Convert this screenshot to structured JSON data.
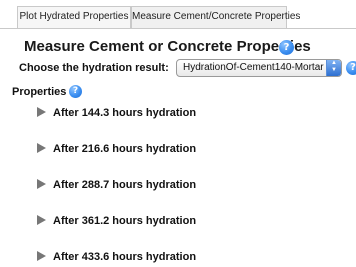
{
  "tabs": [
    {
      "label": "Plot Hydrated Properties"
    },
    {
      "label": "Measure Cement/Concrete Properties"
    }
  ],
  "page": {
    "title": "Measure Cement or Concrete Properties",
    "choose_label": "Choose the hydration result:",
    "selected_result": "HydrationOf-Cement140-Mortar",
    "properties_label": "Properties",
    "help_glyph": "?"
  },
  "properties": [
    {
      "label": "After 144.3 hours hydration"
    },
    {
      "label": "After 216.6 hours hydration"
    },
    {
      "label": "After 288.7 hours hydration"
    },
    {
      "label": "After 361.2 hours hydration"
    },
    {
      "label": "After 433.6 hours hydration"
    }
  ],
  "colors": {
    "help_icon": "#3b8ef0",
    "select_arrow": "#2d6fd0",
    "disclosure_triangle": "#777777"
  }
}
